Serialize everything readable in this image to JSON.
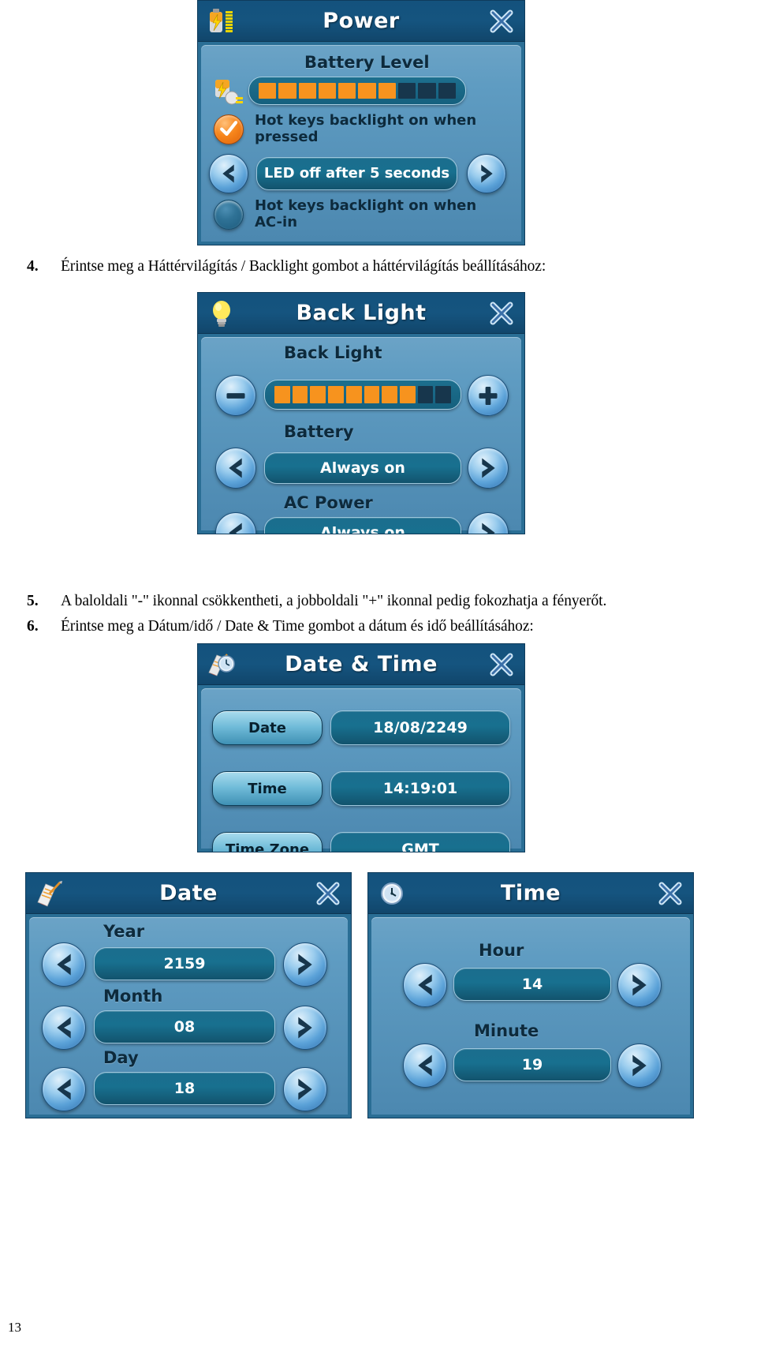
{
  "document": {
    "page_number": "13",
    "steps": [
      {
        "num": "4.",
        "text": "Érintse meg a Háttérvilágítás / Backlight gombot a háttérvilágítás beállításához:"
      },
      {
        "num": "5.",
        "text": "A baloldali \"-\" ikonnal csökkentheti, a jobboldali \"+\" ikonnal pedig fokozhatja a fényerőt."
      },
      {
        "num": "6.",
        "text": "Érintse meg a Dátum/idő / Date & Time gombot a dátum és idő beállításához:"
      }
    ]
  },
  "colors": {
    "panel_bg": "#2a6e95",
    "title_bar": "#14527d",
    "accent_orange": "#f7931e",
    "value_box": "#17708f",
    "segment_off": "#17364c"
  },
  "power_panel": {
    "title": "Power",
    "title_icon": "battery-icon",
    "close_icon": "close-icon",
    "battery_level_label": "Battery Level",
    "battery_icon": "battery-plug-icon",
    "battery_level": {
      "segments_total": 10,
      "segments_on": 7
    },
    "hotkey_pressed": {
      "checkbox_icon": "check-circle-icon",
      "checked": true,
      "label": "Hot keys backlight on when pressed"
    },
    "led_timeout": {
      "prev_icon": "chevron-left-icon",
      "next_icon": "chevron-right-icon",
      "value": "LED off after 5 seconds"
    },
    "hotkey_acin": {
      "checkbox_icon": "radio-empty-icon",
      "checked": false,
      "label": "Hot keys backlight on when AC-in"
    }
  },
  "backlight_panel": {
    "title": "Back Light",
    "title_icon": "lightbulb-icon",
    "close_icon": "close-icon",
    "backlight_label": "Back Light",
    "minus_icon": "minus-icon",
    "plus_icon": "plus-icon",
    "backlight_level": {
      "segments_total": 10,
      "segments_on": 8
    },
    "battery_label": "Battery",
    "battery_value": "Always on",
    "ac_power_label": "AC Power",
    "ac_power_value": "Always on",
    "prev_icon": "chevron-left-icon",
    "next_icon": "chevron-right-icon"
  },
  "datetime_panel": {
    "title": "Date & Time",
    "title_icon": "calendar-clock-icon",
    "close_icon": "close-icon",
    "rows": [
      {
        "button": "Date",
        "value": "18/08/2249"
      },
      {
        "button": "Time",
        "value": "14:19:01"
      },
      {
        "button": "Time Zone",
        "value": "GMT"
      }
    ]
  },
  "date_panel": {
    "title": "Date",
    "title_icon": "calendar-icon",
    "close_icon": "close-icon",
    "prev_icon": "chevron-left-icon",
    "next_icon": "chevron-right-icon",
    "fields": [
      {
        "label": "Year",
        "value": "2159"
      },
      {
        "label": "Month",
        "value": "08"
      },
      {
        "label": "Day",
        "value": "18"
      }
    ]
  },
  "time_panel": {
    "title": "Time",
    "title_icon": "clock-icon",
    "close_icon": "close-icon",
    "prev_icon": "chevron-left-icon",
    "next_icon": "chevron-right-icon",
    "fields": [
      {
        "label": "Hour",
        "value": "14"
      },
      {
        "label": "Minute",
        "value": "19"
      }
    ]
  }
}
